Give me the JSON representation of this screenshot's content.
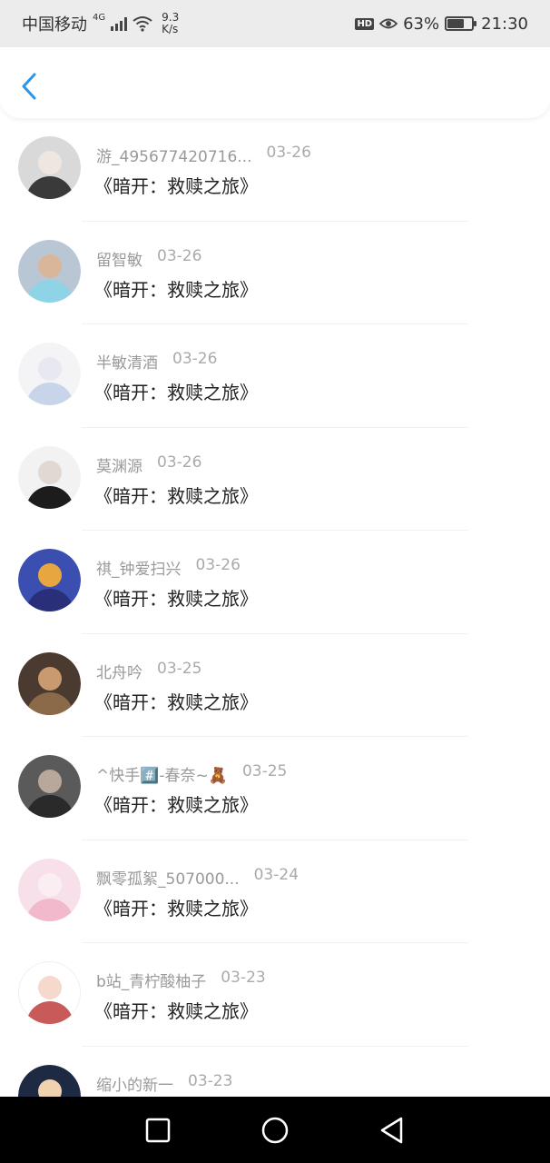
{
  "status_bar": {
    "carrier": "中国移动",
    "network": "4G",
    "speed_value": "9.3",
    "speed_unit": "K/s",
    "hd_label": "HD",
    "battery": "63%",
    "battery_fraction": 0.63,
    "time": "21:30"
  },
  "header": {
    "back_icon": "chevron-left-icon",
    "accent": "#2b95e9"
  },
  "list": {
    "items": [
      {
        "name": "游_495677420716...",
        "date": "03-26",
        "text": "《暗开：救赎之旅》"
      },
      {
        "name": "留智敏",
        "date": "03-26",
        "text": "《暗开：救赎之旅》"
      },
      {
        "name": "半敏清酒",
        "date": "03-26",
        "text": "《暗开：救赎之旅》"
      },
      {
        "name": "莫渊源",
        "date": "03-26",
        "text": "《暗开：救赎之旅》"
      },
      {
        "name": "祺_钟爱扫兴",
        "date": "03-26",
        "text": "《暗开：救赎之旅》"
      },
      {
        "name": "北舟吟",
        "date": "03-25",
        "text": "《暗开：救赎之旅》"
      },
      {
        "name": "^快手#️⃣-春奈~🧸",
        "date": "03-25",
        "text": "《暗开：救赎之旅》"
      },
      {
        "name": "飘零孤絮_507000...",
        "date": "03-24",
        "text": "《暗开：救赎之旅》"
      },
      {
        "name": "b站_青柠酸柚子",
        "date": "03-23",
        "text": "《暗开：救赎之旅》"
      },
      {
        "name": "缩小的新一",
        "date": "03-23",
        "text": ""
      }
    ]
  },
  "nav_bar": {
    "recents_icon": "square-icon",
    "home_icon": "circle-icon",
    "back_icon": "triangle-back-icon"
  }
}
